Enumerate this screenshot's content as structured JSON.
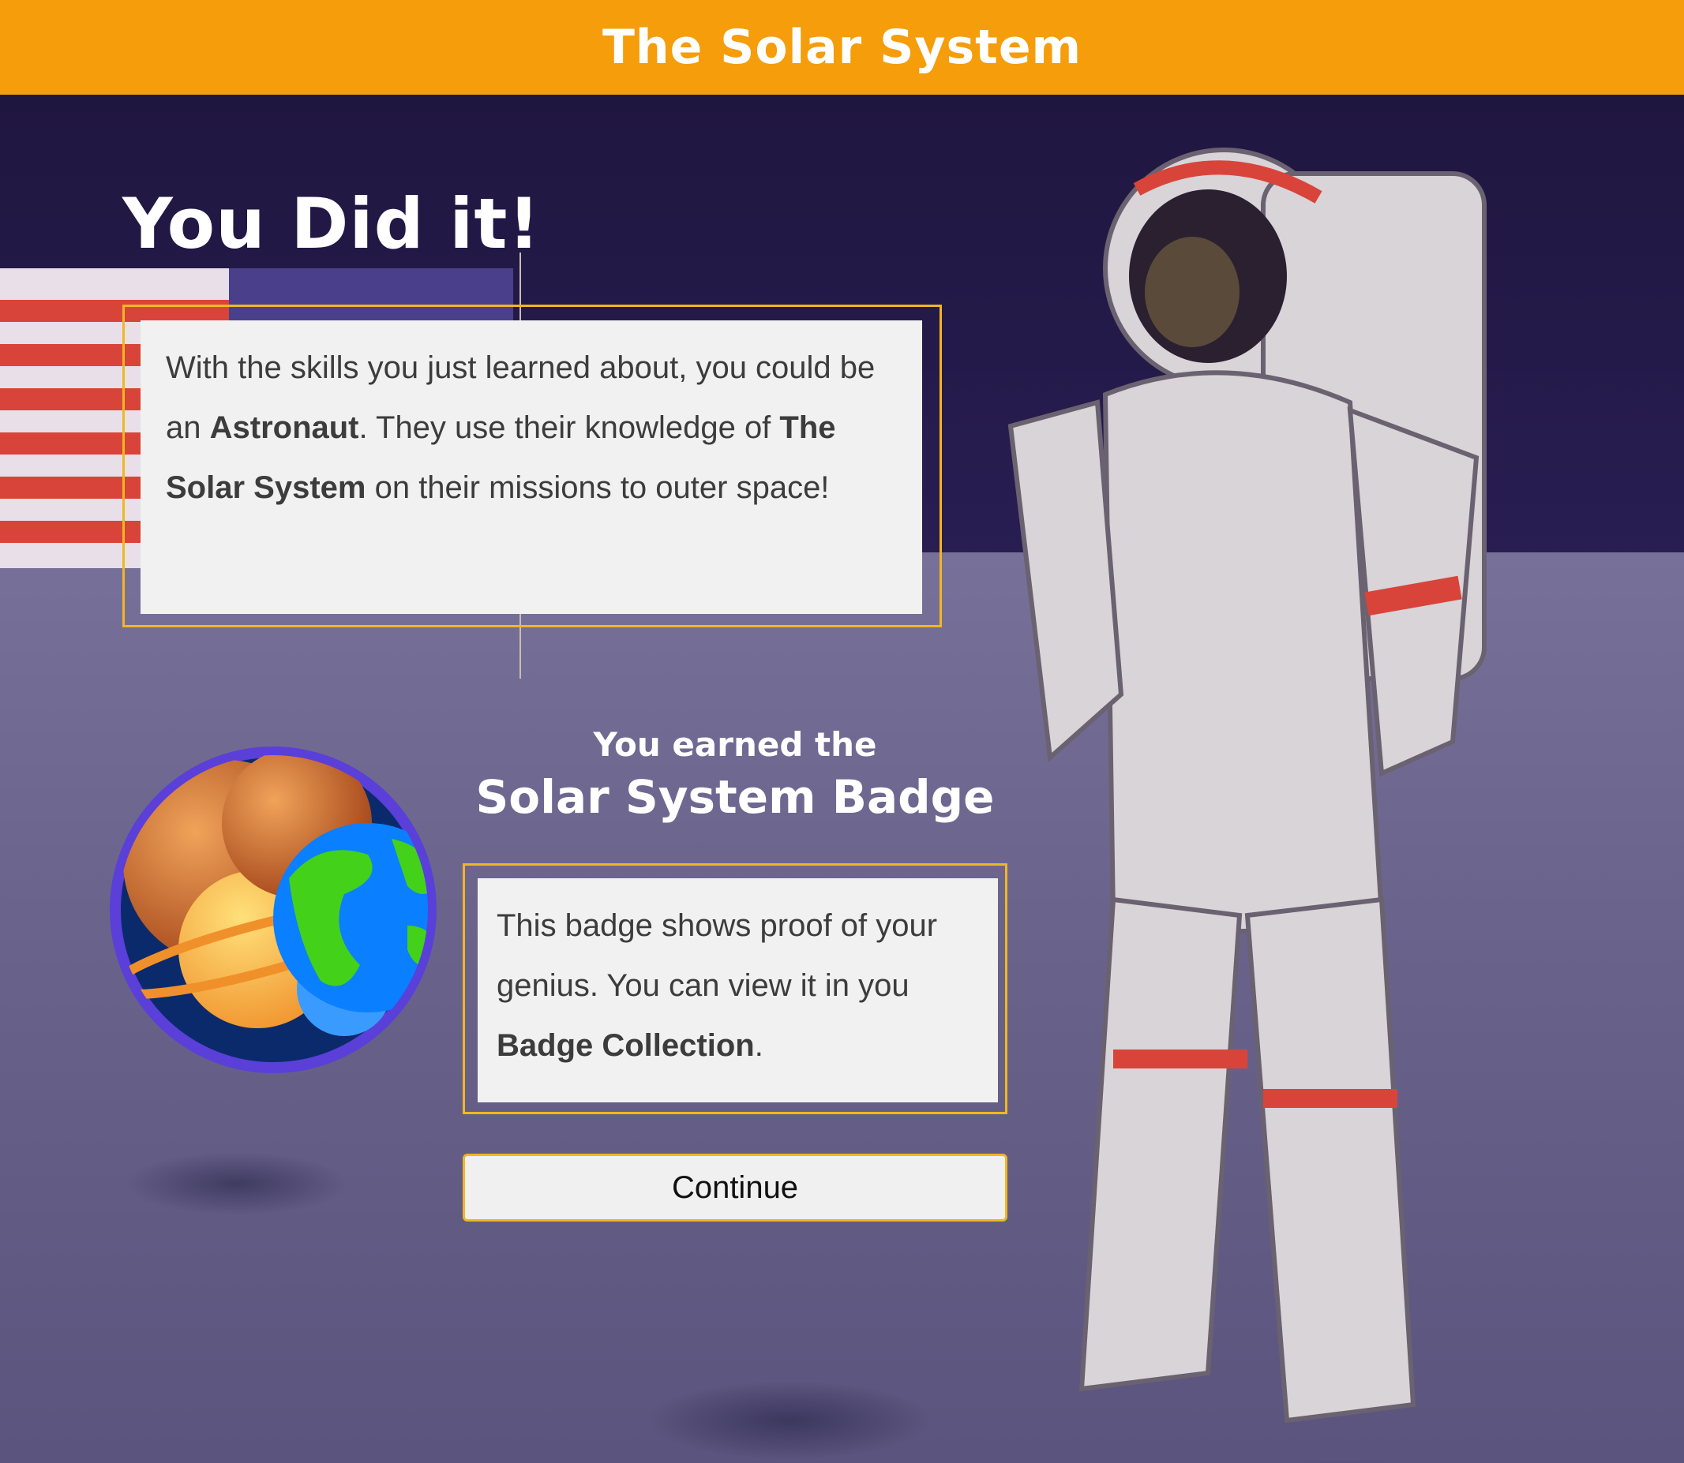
{
  "header": {
    "title": "The Solar System"
  },
  "main": {
    "heading": "You Did it!",
    "intro": {
      "part1": "With the skills you just learned about, you could be an ",
      "bold1": "Astronaut",
      "part2": ". They use their knowledge of ",
      "bold2": "The Solar System",
      "part3": " on their missions to outer space!"
    },
    "badge": {
      "earned_line1": "You earned the",
      "earned_line2": "Solar System Badge",
      "icon": "solar-system-badge-icon",
      "description": {
        "part1": "This badge shows proof of your genius. You can view it in you ",
        "bold1": "Badge Collection",
        "part2": "."
      }
    },
    "continue_label": "Continue"
  },
  "colors": {
    "header": "#f59d0a",
    "accent_border": "#f2b71f",
    "card_bg": "#f1f1f1",
    "badge_ring": "#5a3fd8"
  }
}
